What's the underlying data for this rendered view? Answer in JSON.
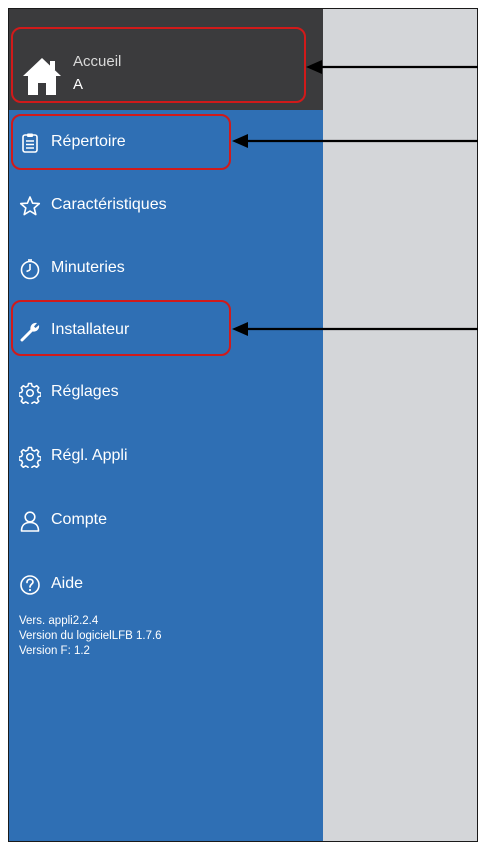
{
  "header": {
    "title": "Accueil",
    "subtitle": "A"
  },
  "menu": [
    {
      "label": "Répertoire",
      "icon": "clipboard-icon"
    },
    {
      "label": "Caractéristiques",
      "icon": "star-icon"
    },
    {
      "label": "Minuteries",
      "icon": "timer-icon"
    },
    {
      "label": "Installateur",
      "icon": "wrench-icon"
    },
    {
      "label": "Réglages",
      "icon": "gear-icon"
    },
    {
      "label": "Régl. Appli",
      "icon": "gear-icon"
    },
    {
      "label": "Compte",
      "icon": "person-icon"
    },
    {
      "label": "Aide",
      "icon": "help-icon"
    }
  ],
  "version": {
    "app": "Vers. appli2.2.4",
    "software": "Version du logicielLFB 1.7.6",
    "f": "Version F: 1.2"
  },
  "colors": {
    "drawer": "#2f6fb4",
    "header": "#3b3b3d",
    "content": "#d4d6d9",
    "highlight": "#d11a1a"
  }
}
